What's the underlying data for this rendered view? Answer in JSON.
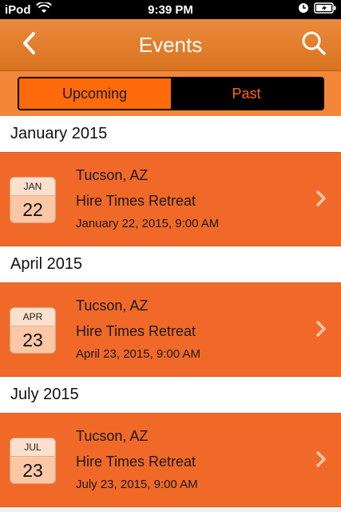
{
  "status_bar": {
    "carrier": "iPod",
    "time": "9:39 PM"
  },
  "nav": {
    "title": "Events"
  },
  "segments": {
    "upcoming": "Upcoming",
    "past": "Past"
  },
  "sections": [
    {
      "header": "January 2015",
      "event": {
        "month": "JAN",
        "day": "22",
        "city": "Tucson, AZ",
        "title": "Hire Times Retreat",
        "datetime": "January 22, 2015, 9:00 AM"
      }
    },
    {
      "header": "April 2015",
      "event": {
        "month": "APR",
        "day": "23",
        "city": "Tucson, AZ",
        "title": "Hire Times Retreat",
        "datetime": "April 23, 2015, 9:00 AM"
      }
    },
    {
      "header": "July 2015",
      "event": {
        "month": "JUL",
        "day": "23",
        "city": "Tucson, AZ",
        "title": "Hire Times Retreat",
        "datetime": "July 23, 2015, 9:00 AM"
      }
    }
  ],
  "colors": {
    "nav": "#e07f2e",
    "row": "#f16928",
    "accent": "#ff6a0a"
  },
  "icons": {
    "back": "chevron-left-icon",
    "search": "search-icon",
    "row": "chevron-right-icon"
  }
}
